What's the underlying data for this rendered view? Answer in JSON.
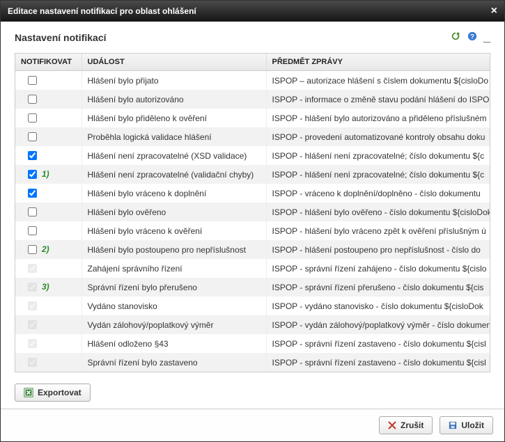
{
  "dialog": {
    "title": "Editace nastavení notifikací pro oblast ohlášení"
  },
  "panel": {
    "title": "Nastavení notifikací"
  },
  "columns": {
    "notify": "NOTIFIKOVAT",
    "event": "UDÁLOST",
    "subject": "PŘEDMĚT ZPRÁVY"
  },
  "rows": [
    {
      "checked": false,
      "enabled": true,
      "anno": "",
      "event": "Hlášení bylo přijato",
      "subject": "ISPOP – autorizace hlášení s číslem dokumentu ${cisloDo"
    },
    {
      "checked": false,
      "enabled": true,
      "anno": "",
      "event": "Hlášení bylo autorizováno",
      "subject": "ISPOP - informace o změně stavu podání hlášení do ISPO"
    },
    {
      "checked": false,
      "enabled": true,
      "anno": "",
      "event": "Hlášení bylo přiděleno k ověření",
      "subject": "ISPOP - hlášení bylo autorizováno a přiděleno příslušném"
    },
    {
      "checked": false,
      "enabled": true,
      "anno": "",
      "event": "Proběhla logická validace hlášení",
      "subject": "ISPOP - provedení automatizované kontroly obsahu doku"
    },
    {
      "checked": true,
      "enabled": true,
      "anno": "",
      "event": "Hlášení není zpracovatelné (XSD validace)",
      "subject": "ISPOP - hlášení není zpracovatelné; číslo dokumentu ${c"
    },
    {
      "checked": true,
      "enabled": true,
      "anno": "1)",
      "event": "Hlášení není zpracovatelné (validační chyby)",
      "subject": "ISPOP - hlášení není zpracovatelné; číslo dokumentu ${c"
    },
    {
      "checked": true,
      "enabled": true,
      "anno": "",
      "event": "Hlášení bylo vráceno k doplnění",
      "subject": "ISPOP - vráceno k doplnění/doplněno - číslo dokumentu"
    },
    {
      "checked": false,
      "enabled": true,
      "anno": "",
      "event": "Hlášení bylo ověřeno",
      "subject": "ISPOP - hlášení bylo ověřeno - číslo dokumentu ${cisloDokum"
    },
    {
      "checked": false,
      "enabled": true,
      "anno": "",
      "event": "Hlášení bylo vráceno k ověření",
      "subject": "ISPOP - hlášení bylo vráceno zpět k ověření příslušným ú"
    },
    {
      "checked": false,
      "enabled": true,
      "anno": "2)",
      "event": "Hlášení bylo postoupeno pro nepříslušnost",
      "subject": "ISPOP - hlášení postoupeno pro nepříslušnost - číslo do"
    },
    {
      "checked": true,
      "enabled": false,
      "anno": "",
      "event": "Zahájení správního řízení",
      "subject": "ISPOP - správní řízení zahájeno - číslo dokumentu ${cislo"
    },
    {
      "checked": true,
      "enabled": false,
      "anno": "3)",
      "event": "Správní řízení bylo přerušeno",
      "subject": "ISPOP - správní řízení přerušeno - číslo dokumentu ${cis"
    },
    {
      "checked": true,
      "enabled": false,
      "anno": "",
      "event": "Vydáno stanovisko",
      "subject": "ISPOP - vydáno stanovisko - číslo dokumentu ${cisloDok"
    },
    {
      "checked": true,
      "enabled": false,
      "anno": "",
      "event": "Vydán zálohový/poplatkový výměr",
      "subject": "ISPOP - vydán zálohový/poplatkový výměr - číslo dokumen"
    },
    {
      "checked": true,
      "enabled": false,
      "anno": "",
      "event": "Hlášení odloženo §43",
      "subject": "ISPOP - správní řízení zastaveno - číslo dokumentu ${cisl"
    },
    {
      "checked": true,
      "enabled": false,
      "anno": "",
      "event": "Správní řízení bylo zastaveno",
      "subject": "ISPOP - správní řízení zastaveno - číslo dokumentu ${cisl"
    }
  ],
  "buttons": {
    "export": "Exportovat",
    "cancel": "Zrušit",
    "save": "Uložit"
  }
}
